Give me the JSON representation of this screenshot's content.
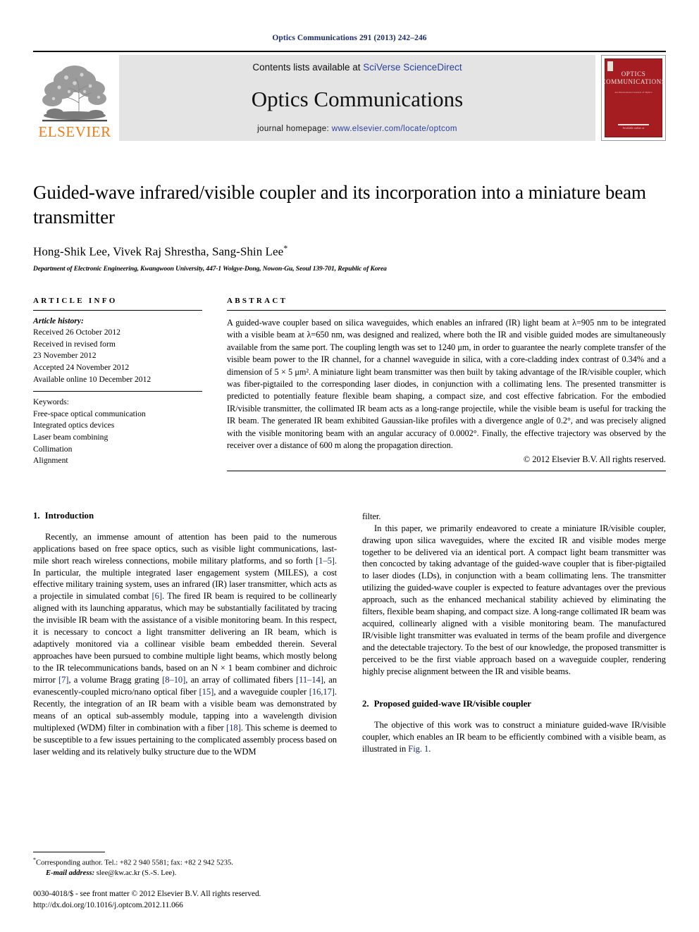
{
  "running_head": "Optics Communications 291 (2013) 242–246",
  "masthead": {
    "publisher_name": "ELSEVIER",
    "contents_prefix": "Contents lists available at ",
    "contents_link": "SciVerse ScienceDirect",
    "journal_name": "Optics Communications",
    "homepage_prefix": "journal homepage: ",
    "homepage_link": "www.elsevier.com/locate/optcom",
    "cover_title": "OPTICS COMMUNICATIONS",
    "cover_subtitle": "An International Journal of Optics",
    "cover_footer": "Available online at",
    "link_color": "#2a3f9d",
    "cover_color": "#a51c21",
    "elsevier_orange": "#ef7c1a"
  },
  "article": {
    "title": "Guided-wave infrared/visible coupler and its incorporation into a miniature beam transmitter",
    "authors": "Hong-Shik Lee, Vivek Raj Shrestha, Sang-Shin Lee",
    "author_marker": "*",
    "affiliation": "Department of Electronic Engineering, Kwangwoon University, 447-1 Wolgye-Dong, Nowon-Gu, Seoul 139-701, Republic of Korea"
  },
  "article_info": {
    "heading": "ARTICLE INFO",
    "history_label": "Article history:",
    "history": [
      "Received 26 October 2012",
      "Received in revised form",
      "23 November 2012",
      "Accepted 24 November 2012",
      "Available online 10 December 2012"
    ],
    "keywords_label": "Keywords:",
    "keywords": [
      "Free-space optical communication",
      "Integrated optics devices",
      "Laser beam combining",
      "Collimation",
      "Alignment"
    ]
  },
  "abstract": {
    "heading": "ABSTRACT",
    "text": "A guided-wave coupler based on silica waveguides, which enables an infrared (IR) light beam at λ=905 nm to be integrated with a visible beam at λ=650 nm, was designed and realized, where both the IR and visible guided modes are simultaneously available from the same port. The coupling length was set to 1240 μm, in order to guarantee the nearly complete transfer of the visible beam power to the IR channel, for a channel waveguide in silica, with a core-cladding index contrast of 0.34% and a dimension of 5 × 5 μm². A miniature light beam transmitter was then built by taking advantage of the IR/visible coupler, which was fiber-pigtailed to the corresponding laser diodes, in conjunction with a collimating lens. The presented transmitter is predicted to potentially feature flexible beam shaping, a compact size, and cost effective fabrication. For the embodied IR/visible transmitter, the collimated IR beam acts as a long-range projectile, while the visible beam is useful for tracking the IR beam. The generated IR beam exhibited Gaussian-like profiles with a divergence angle of 0.2°, and was precisely aligned with the visible monitoring beam with an angular accuracy of 0.0002°. Finally, the effective trajectory was observed by the receiver over a distance of 600 m along the propagation direction.",
    "copyright": "© 2012 Elsevier B.V. All rights reserved."
  },
  "sections": {
    "intro": {
      "number": "1.",
      "title": "Introduction",
      "p1_a": "Recently, an immense amount of attention has been paid to the numerous applications based on free space optics, such as visible light communications, last-mile short reach wireless connections, mobile military platforms, and so forth ",
      "p1_r1": "[1–5]",
      "p1_b": ". In particular, the multiple integrated laser engagement system (MILES), a cost effective military training system, uses an infrared (IR) laser transmitter, which acts as a projectile in simulated combat ",
      "p1_r2": "[6]",
      "p1_c": ". The fired IR beam is required to be collinearly aligned with its launching apparatus, which may be substantially facilitated by tracing the invisible IR beam with the assistance of a visible monitoring beam. In this respect, it is necessary to concoct a light transmitter delivering an IR beam, which is adaptively monitored via a collinear visible beam embedded therein. Several approaches have been pursued to combine multiple light beams, which mostly belong to the IR telecommunications bands, based on an N × 1 beam combiner and dichroic mirror ",
      "p1_r3": "[7]",
      "p1_d": ", a volume Bragg grating ",
      "p1_r4": "[8–10]",
      "p1_e": ", an array of collimated fibers ",
      "p1_r5": "[11–14]",
      "p1_f": ", an evanescently-coupled micro/nano optical fiber ",
      "p1_r6": "[15]",
      "p1_g": ", and a waveguide coupler ",
      "p1_r7": "[16,17]",
      "p1_h": ". Recently, the integration of an IR beam with a visible beam was demonstrated by means of an optical sub-assembly module, tapping into a wavelength division multiplexed (WDM) filter in combination with a fiber ",
      "p1_r8": "[18]",
      "p1_i": ". This scheme is deemed to be susceptible to a few issues pertaining to the complicated assembly process based on laser welding and its relatively bulky structure due to the WDM filter.",
      "p2": "In this paper, we primarily endeavored to create a miniature IR/visible coupler, drawing upon silica waveguides, where the excited IR and visible modes merge together to be delivered via an identical port. A compact light beam transmitter was then concocted by taking advantage of the guided-wave coupler that is fiber-pigtailed to laser diodes (LDs), in conjunction with a beam collimating lens. The transmitter utilizing the guided-wave coupler is expected to feature advantages over the previous approach, such as the enhanced mechanical stability achieved by eliminating the filters, flexible beam shaping, and compact size. A long-range collimated IR beam was acquired, collinearly aligned with a visible monitoring beam. The manufactured IR/visible light transmitter was evaluated in terms of the beam profile and divergence and the detectable trajectory. To the best of our knowledge, the proposed transmitter is perceived to be the first viable approach based on a waveguide coupler, rendering highly precise alignment between the IR and visible beams."
    },
    "coupler": {
      "number": "2.",
      "title": "Proposed guided-wave IR/visible coupler",
      "p1_a": "The objective of this work was to construct a miniature guided-wave IR/visible coupler, which enables an IR beam to be efficiently combined with a visible beam, as illustrated in ",
      "p1_r1": "Fig. 1",
      "p1_b": "."
    }
  },
  "footer": {
    "corr_marker": "*",
    "corr_text": "Corresponding author. Tel.: +82 2 940 5581; fax: +82 2 942 5235.",
    "email_label": "E-mail address:",
    "email_text": " slee@kw.ac.kr (S.-S. Lee).",
    "issn_line": "0030-4018/$ - see front matter © 2012 Elsevier B.V. All rights reserved.",
    "doi_line": "http://dx.doi.org/10.1016/j.optcom.2012.11.066"
  }
}
